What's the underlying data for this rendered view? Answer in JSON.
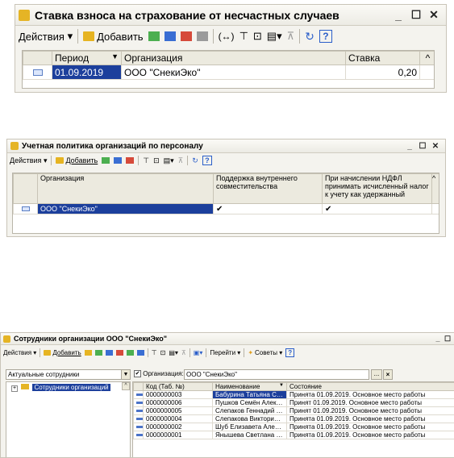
{
  "w1": {
    "title": "Ставка взноса на страхование от несчастных случаев",
    "win_buttons": [
      "_",
      "☐",
      "✕"
    ],
    "toolbar": {
      "actions": "Действия",
      "add": "Добавить"
    },
    "columns": [
      "Период",
      "Организация",
      "Ставка"
    ],
    "rows": [
      {
        "period": "01.09.2019",
        "org": "ООО \"СнекиЭко\"",
        "rate": "0,20"
      }
    ]
  },
  "w2": {
    "title": "Учетная политика организаций по персоналу",
    "win_buttons": [
      "_",
      "☐",
      "✕"
    ],
    "toolbar": {
      "actions": "Действия",
      "add": "Добавить"
    },
    "columns": [
      "Организация",
      "Поддержка внутреннего совместительства",
      "При начислении НДФЛ принимать исчисленный налог к учету как удержанный"
    ],
    "rows": [
      {
        "org": "ООО \"СнекиЭко\"",
        "c1": "✔",
        "c2": "✔"
      }
    ]
  },
  "w3": {
    "title": "Сотрудники организации ООО \"СнекиЭко\"",
    "win_buttons": [
      "_",
      "☐"
    ],
    "toolbar": {
      "actions": "Действия",
      "add": "Добавить",
      "goto": "Перейти",
      "tips": "Советы"
    },
    "filter_value": "Актуальные сотрудники",
    "org_label": "Организация:",
    "org_value": "ООО \"СнекиЭко\"",
    "tree_item": "Сотрудники организаций",
    "columns": [
      "Код (Таб. №)",
      "Наименование",
      "Состояние"
    ],
    "rows": [
      {
        "code": "0000000003",
        "name": "Бабурина Татьяна Сте...",
        "state": "Принята 01.09.2019. Основное место работы"
      },
      {
        "code": "0000000006",
        "name": "Пушков Семён Алексе...",
        "state": "Принят 01.09.2019. Основное место работы"
      },
      {
        "code": "0000000005",
        "name": "Слепаков Геннадий Ви...",
        "state": "Принят 01.09.2019. Основное место работы"
      },
      {
        "code": "0000000004",
        "name": "Слепакова Виктория А...",
        "state": "Принята 01.09.2019. Основное место работы"
      },
      {
        "code": "0000000002",
        "name": "Шуб Елизавета Алекса...",
        "state": "Принята 01.09.2019. Основное место работы"
      },
      {
        "code": "0000000001",
        "name": "Янышева Светлана Ал...",
        "state": "Принята 01.09.2019. Основное место работы"
      }
    ]
  }
}
